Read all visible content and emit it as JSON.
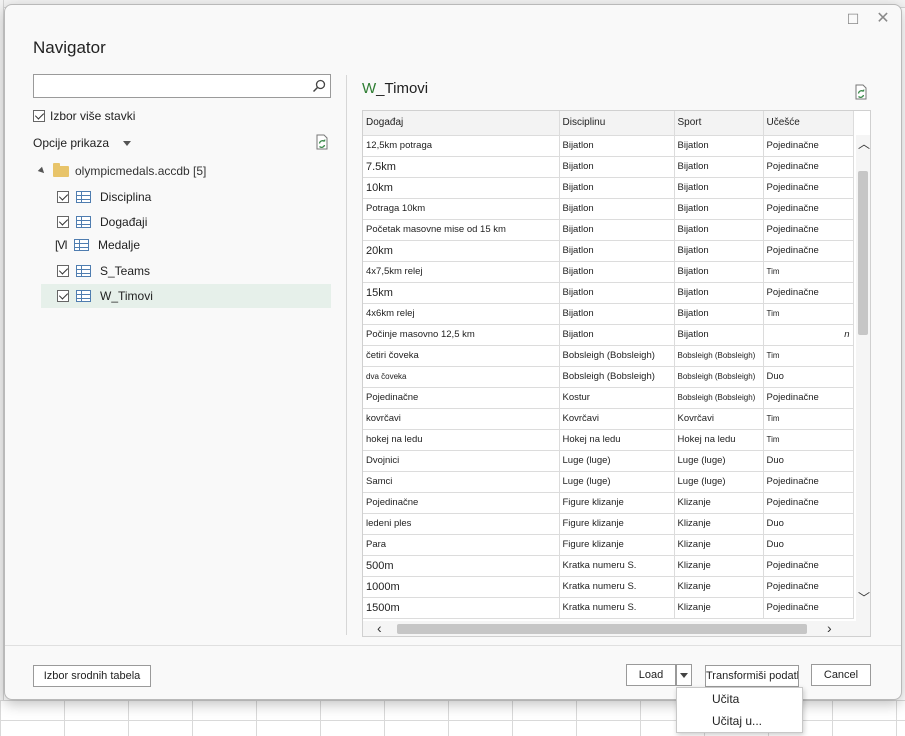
{
  "window": {
    "title": "Navigator"
  },
  "left": {
    "search_placeholder": "",
    "multi_select_label": "Izbor više stavki",
    "display_options_label": "Opcije prikaza",
    "tree": {
      "root_label": "olympicmedals.accdb [5]",
      "items": [
        {
          "label": "Disciplina",
          "state": "checked"
        },
        {
          "label": "Događaji",
          "state": "checked"
        },
        {
          "label": "Medalje",
          "state": "partial",
          "mark": "[VI"
        },
        {
          "label": "S_Teams",
          "state": "checked"
        },
        {
          "label": "W_Timovi",
          "state": "checked",
          "selected": true
        }
      ]
    }
  },
  "preview": {
    "title_prefix": "W",
    "title_rest": "_Timovi",
    "columns": [
      "Događaj",
      "Disciplinu",
      "Sport",
      "Učešće"
    ],
    "rows": [
      [
        "12,5km potraga",
        "Bijatlon",
        "Bijatlon",
        "Pojedinačne"
      ],
      [
        "7.5km",
        "Bijatlon",
        "Bijatlon",
        "Pojedinačne"
      ],
      [
        "10km",
        "Bijatlon",
        "Bijatlon",
        "Pojedinačne"
      ],
      [
        "Potraga 10km",
        "Bijatlon",
        "Bijatlon",
        "Pojedinačne"
      ],
      [
        "Početak masovne mise od 15 km",
        "Bijatlon",
        "Bijatlon",
        "Pojedinačne"
      ],
      [
        "20km",
        "Bijatlon",
        "Bijatlon",
        "Pojedinačne"
      ],
      [
        "4x7,5km relej",
        "Bijatlon",
        "Bijatlon",
        "Tim"
      ],
      [
        "15km",
        "Bijatlon",
        "Bijatlon",
        "Pojedinačne"
      ],
      [
        "4x6km relej",
        "Bijatlon",
        "Bijatlon",
        "Tim"
      ],
      [
        "Počinje masovno 12,5 km",
        "Bijatlon",
        "Bijatlon",
        "n"
      ],
      [
        "četiri čoveka",
        "Bobsleigh (Bobsleigh)",
        "Bobsleigh (Bobsleigh)",
        "Tim"
      ],
      [
        "dva čoveka",
        "Bobsleigh (Bobsleigh)",
        "Bobsleigh (Bobsleigh)",
        "Duo"
      ],
      [
        "Pojedinačne",
        "Kostur",
        "Bobsleigh (Bobsleigh)",
        "Pojedinačne"
      ],
      [
        "kovrčavi",
        "Kovrčavi",
        "Kovrčavi",
        "Tim"
      ],
      [
        "hokej na ledu",
        "Hokej na ledu",
        "Hokej na ledu",
        "Tim"
      ],
      [
        "Dvojnici",
        "Luge (luge)",
        "Luge (luge)",
        "Duo"
      ],
      [
        "Samci",
        "Luge (luge)",
        "Luge (luge)",
        "Pojedinačne"
      ],
      [
        "Pojedinačne",
        "Figure klizanje",
        "Klizanje",
        "Pojedinačne"
      ],
      [
        "ledeni ples",
        "Figure klizanje",
        "Klizanje",
        "Duo"
      ],
      [
        "Para",
        "Figure klizanje",
        "Klizanje",
        "Duo"
      ],
      [
        "500m",
        "Kratka numeru S.",
        "Klizanje",
        "Pojedinačne"
      ],
      [
        "1000m",
        "Kratka numeru S.",
        "Klizanje",
        "Pojedinačne"
      ],
      [
        "1500m",
        "Kratka numeru S.",
        "Klizanje",
        "Pojedinačne"
      ]
    ]
  },
  "footer": {
    "related_tables_label": "Izbor srodnih tabela",
    "load_label": "Load",
    "transform_label": "Transformiši podatke",
    "cancel_label": "Cancel"
  },
  "load_menu": {
    "items": [
      "Učita",
      "Učitaj u..."
    ]
  },
  "colors": {
    "accent_green": "#2e7d32",
    "selected_row": "#e6f0ea",
    "table_icon": "#4f7db0"
  }
}
